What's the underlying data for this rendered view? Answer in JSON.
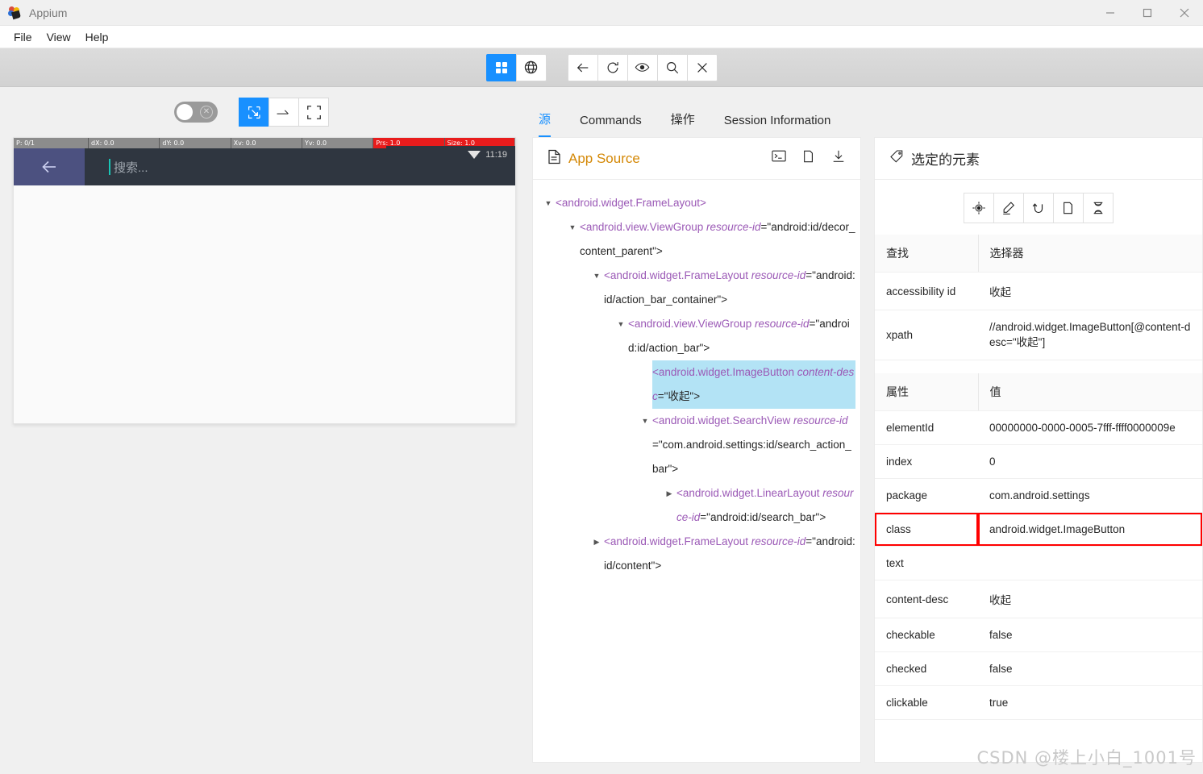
{
  "window": {
    "title": "Appium",
    "icon": "appium-logo-icon",
    "controls": [
      {
        "name": "minimize-button",
        "glyph": "minimize-icon"
      },
      {
        "name": "maximize-button",
        "glyph": "maximize-icon"
      },
      {
        "name": "close-button",
        "glyph": "close-icon"
      }
    ]
  },
  "menubar": {
    "items": [
      "File",
      "View",
      "Help"
    ]
  },
  "toolbar": {
    "view_group": [
      {
        "name": "grid-view-button",
        "icon": "grid-icon",
        "active": true
      },
      {
        "name": "web-view-button",
        "icon": "globe-icon",
        "active": false
      }
    ],
    "action_group": [
      {
        "name": "back-button",
        "icon": "arrow-left-icon"
      },
      {
        "name": "refresh-button",
        "icon": "refresh-icon"
      },
      {
        "name": "eye-button",
        "icon": "eye-icon"
      },
      {
        "name": "search-button",
        "icon": "search-icon"
      },
      {
        "name": "quit-session-button",
        "icon": "close-x-icon"
      }
    ]
  },
  "left_panel": {
    "toggle": {
      "name": "source-refresh-toggle",
      "state": "off",
      "icon": "x-circle-icon"
    },
    "modes": [
      {
        "name": "select-element-mode",
        "icon": "select-cursor-icon",
        "active": true
      },
      {
        "name": "swipe-mode",
        "icon": "swipe-arrow-icon",
        "active": false
      },
      {
        "name": "tap-coordinates-mode",
        "icon": "crop-frame-icon",
        "active": false
      }
    ],
    "device": {
      "pointer_bar": [
        {
          "label": "P: 0/1",
          "red": false
        },
        {
          "label": "dX: 0.0",
          "red": false
        },
        {
          "label": "dY: 0.0",
          "red": false
        },
        {
          "label": "Xv: 0.0",
          "red": false
        },
        {
          "label": "Yv: 0.0",
          "red": false
        },
        {
          "label": "Prs: 1.0",
          "red": true
        },
        {
          "label": "Size: 1.0",
          "red": true
        }
      ],
      "status_time": "11:19",
      "back_icon": "arrow-left-icon",
      "search_placeholder": "搜索..."
    }
  },
  "tabs": [
    {
      "label": "源",
      "active": true,
      "name": "tab-source"
    },
    {
      "label": "Commands",
      "active": false,
      "name": "tab-commands"
    },
    {
      "label": "操作",
      "active": false,
      "name": "tab-actions"
    },
    {
      "label": "Session Information",
      "active": false,
      "name": "tab-session-information"
    }
  ],
  "app_source": {
    "title": "App Source",
    "title_icon": "file-document-icon",
    "head_icons": [
      {
        "name": "open-in-terminal-icon",
        "glyph": "terminal-icon"
      },
      {
        "name": "copy-source-icon",
        "glyph": "copy-icon"
      },
      {
        "name": "download-source-icon",
        "glyph": "download-icon"
      }
    ],
    "tree": [
      {
        "indent": 0,
        "caret": "down",
        "tag": "<android.widget.FrameLayout>",
        "attr": "",
        "value": "",
        "selected": false
      },
      {
        "indent": 1,
        "caret": "down",
        "tag": "<android.view.ViewGroup ",
        "attr": "resource-id",
        "value": "=\"android:id/decor_content_parent\">",
        "selected": false
      },
      {
        "indent": 2,
        "caret": "down",
        "tag": "<android.widget.FrameLayout ",
        "attr": "resource-id",
        "value": "=\"android:id/action_bar_container\">",
        "selected": false
      },
      {
        "indent": 3,
        "caret": "down",
        "tag": "<android.view.ViewGroup ",
        "attr": "resource-id",
        "value": "=\"android:id/action_bar\">",
        "selected": false
      },
      {
        "indent": 4,
        "caret": "none",
        "tag": "<android.widget.ImageButton ",
        "attr": "content-desc",
        "value": "=\"收起\">",
        "selected": true
      },
      {
        "indent": 4,
        "caret": "down",
        "tag": "<android.widget.SearchView ",
        "attr": "resource-id",
        "value": "=\"com.android.settings:id/search_action_bar\">",
        "selected": false
      },
      {
        "indent": 5,
        "caret": "right",
        "tag": "<android.widget.LinearLayout ",
        "attr": "resource-id",
        "value": "=\"android:id/search_bar\">",
        "selected": false
      },
      {
        "indent": 2,
        "caret": "right",
        "tag": "<android.widget.FrameLayout ",
        "attr": "resource-id",
        "value": "=\"android:id/content\">",
        "selected": false
      }
    ]
  },
  "selected_element": {
    "title": "选定的元素",
    "title_icon": "tag-icon",
    "actions": [
      {
        "name": "tap-element-button",
        "icon": "target-icon"
      },
      {
        "name": "send-keys-button",
        "icon": "pencil-icon"
      },
      {
        "name": "clear-element-button",
        "icon": "undo-icon"
      },
      {
        "name": "copy-attributes-button",
        "icon": "copy-icon"
      },
      {
        "name": "get-timing-button",
        "icon": "hourglass-icon"
      }
    ],
    "find_table": {
      "headers": [
        "查找",
        "选择器"
      ],
      "rows": [
        {
          "k": "accessibility id",
          "v": "收起"
        },
        {
          "k": "xpath",
          "v": "//android.widget.ImageButton[@content-desc=\"收起\"]"
        }
      ]
    },
    "attr_table": {
      "headers": [
        "属性",
        "值"
      ],
      "rows": [
        {
          "k": "elementId",
          "v": "00000000-0000-0005-7fff-ffff0000009e",
          "highlight": false
        },
        {
          "k": "index",
          "v": "0",
          "highlight": false
        },
        {
          "k": "package",
          "v": "com.android.settings",
          "highlight": false
        },
        {
          "k": "class",
          "v": "android.widget.ImageButton",
          "highlight": true
        },
        {
          "k": "text",
          "v": "",
          "highlight": false
        },
        {
          "k": "content-desc",
          "v": "收起",
          "highlight": false
        },
        {
          "k": "checkable",
          "v": "false",
          "highlight": false
        },
        {
          "k": "checked",
          "v": "false",
          "highlight": false
        },
        {
          "k": "clickable",
          "v": "true",
          "highlight": false
        }
      ]
    }
  },
  "watermark": "CSDN @楼上小白_1001号"
}
